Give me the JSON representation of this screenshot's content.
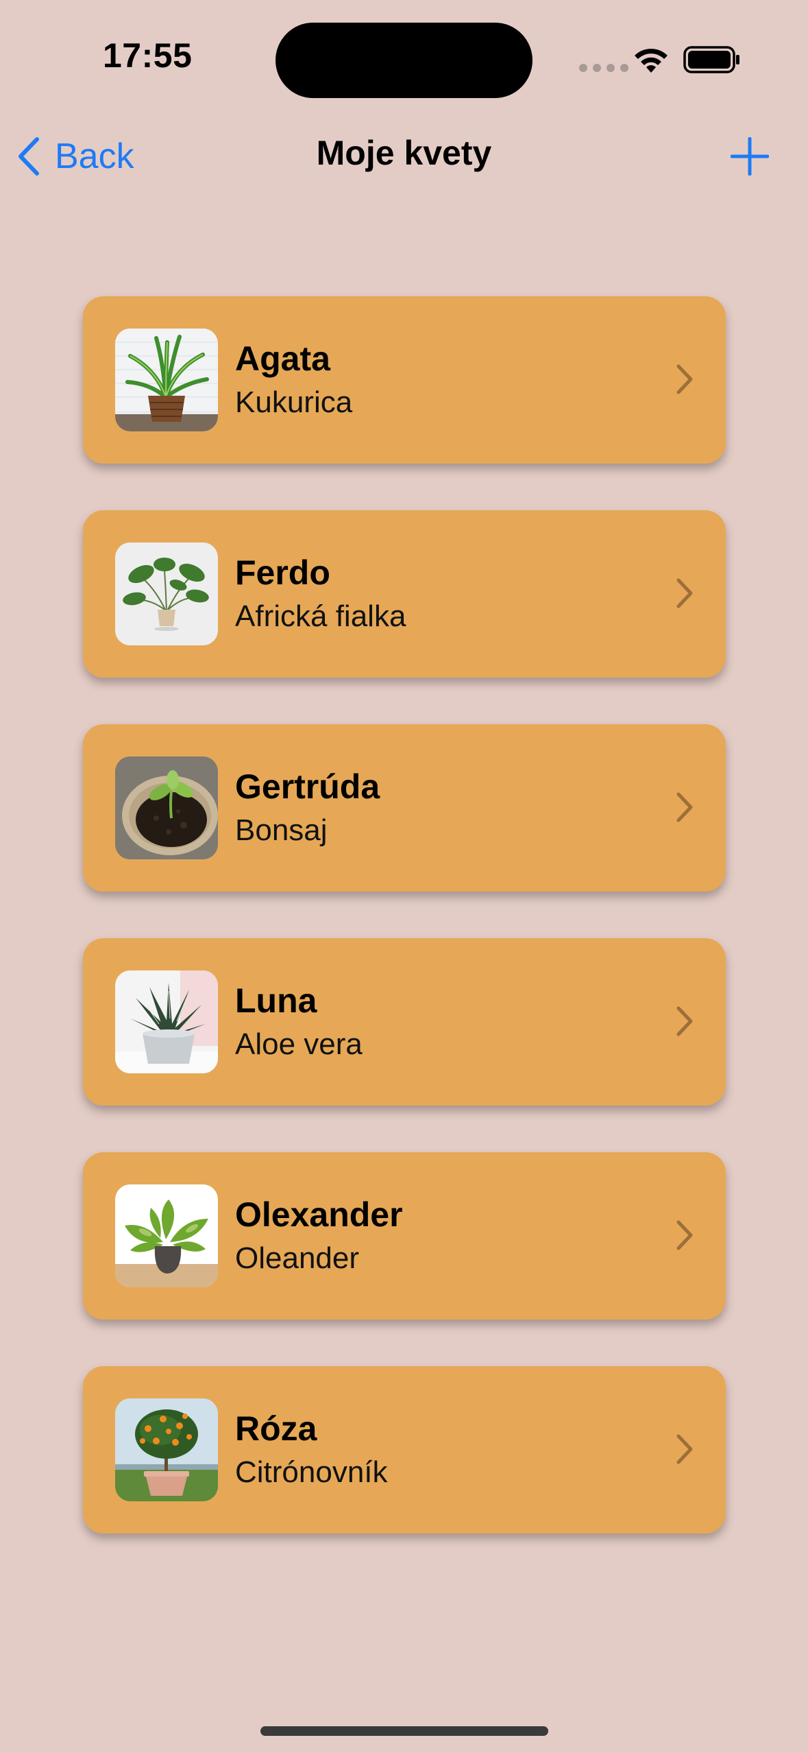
{
  "status_bar": {
    "time": "17:55"
  },
  "nav": {
    "back_label": "Back",
    "title": "Moje kvety"
  },
  "colors": {
    "background": "#E4CCC6",
    "card": "#E6A856",
    "accent": "#1E7BF5"
  },
  "plants": [
    {
      "name": "Agata",
      "species": "Kukurica",
      "image": "dracaena-in-basket"
    },
    {
      "name": "Ferdo",
      "species": "Africká fialka",
      "image": "potted-plant-white-bg"
    },
    {
      "name": "Gertrúda",
      "species": "Bonsaj",
      "image": "seedling-in-pot"
    },
    {
      "name": "Luna",
      "species": "Aloe vera",
      "image": "haworthia-on-windowsill"
    },
    {
      "name": "Olexander",
      "species": "Oleander",
      "image": "pothos-in-pot"
    },
    {
      "name": "Róza",
      "species": "Citrónovník",
      "image": "citrus-tree-in-pot"
    }
  ]
}
